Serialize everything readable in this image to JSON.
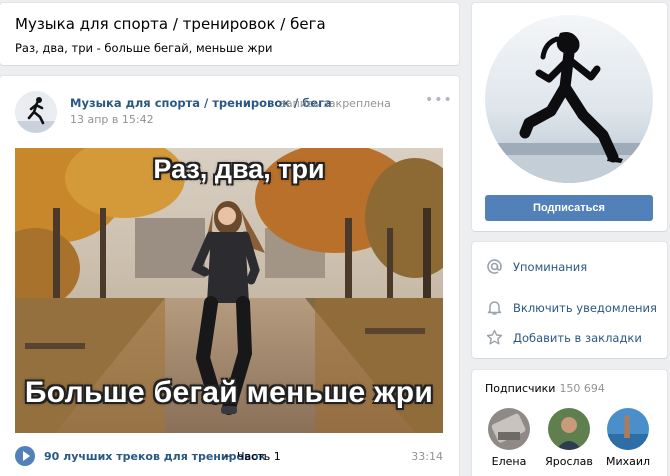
{
  "group": {
    "title": "Музыка для спорта / тренировок / бега",
    "status": "Раз, два, три - больше бегай, меньше жри"
  },
  "post": {
    "author": "Музыка для спорта / тренировок / бега",
    "pinned": "запись закреплена",
    "date": "13 апр в 15:42",
    "more_icon": "more-horizontal-icon",
    "image": {
      "top_text": "Раз, два, три",
      "bottom_text": "Больше бегай меньше  жри"
    },
    "audio": {
      "title": "90 лучших треков для тренировок",
      "separator": "–",
      "part": "Часть 1",
      "duration": "33:14",
      "play_icon": "play-icon"
    }
  },
  "sidebar": {
    "subscribe_label": "Подписаться",
    "menu": [
      {
        "icon": "at-sign-icon",
        "label": "Упоминания"
      },
      {
        "icon": "bell-icon",
        "label": "Включить уведомления"
      },
      {
        "icon": "star-icon",
        "label": "Добавить в закладки"
      }
    ],
    "subscribers": {
      "title": "Подписчики",
      "count": "150 694",
      "people": [
        {
          "name": "Елена"
        },
        {
          "name": "Ярослав"
        },
        {
          "name": "Михаил"
        }
      ]
    }
  },
  "colors": {
    "accent": "#5181b8",
    "link": "#2a5885",
    "muted": "#939393",
    "background": "#edeef0"
  }
}
